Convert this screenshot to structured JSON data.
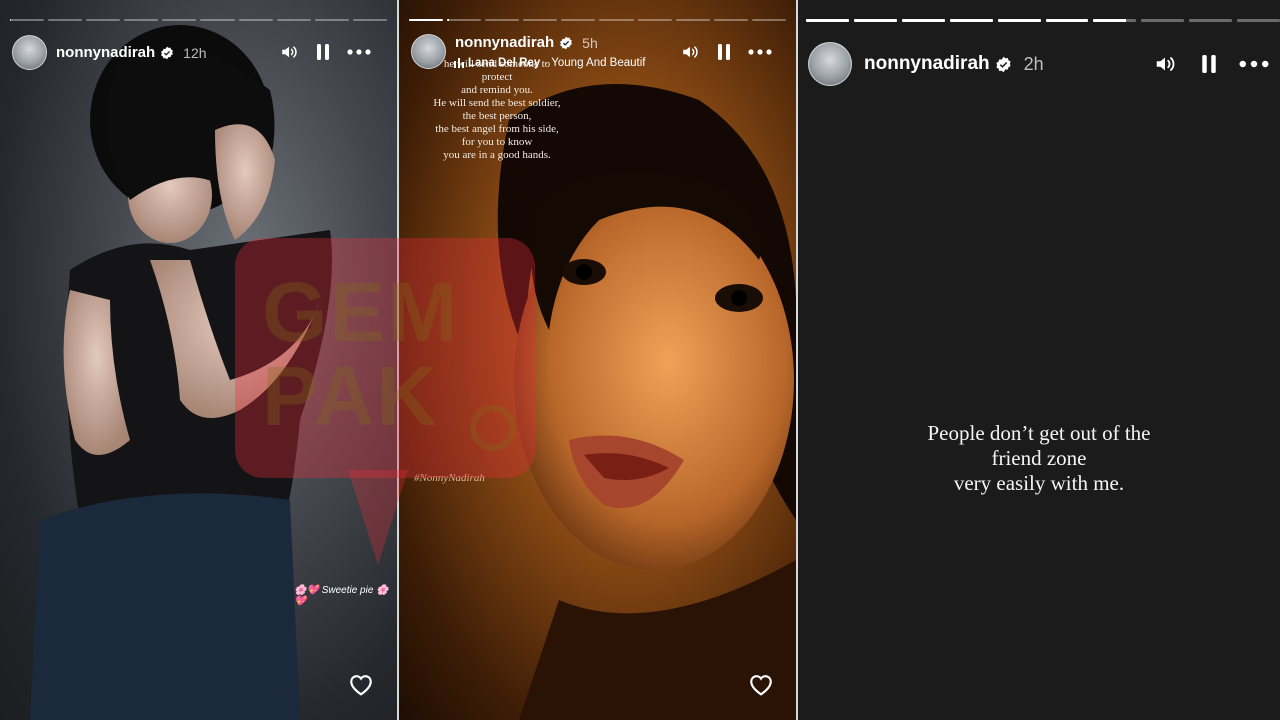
{
  "stories": [
    {
      "username": "nonnynadirah",
      "time": "12h",
      "progress_bars": [
        0.02,
        0,
        0,
        0,
        0,
        0,
        0,
        0,
        0,
        0
      ],
      "sticker_text": "Sweetie pie",
      "sticker_emojis": "🌸💖"
    },
    {
      "username": "nonnynadirah",
      "time": "5h",
      "progress_bars": [
        1,
        0.05,
        0,
        0,
        0,
        0,
        0,
        0,
        0,
        0
      ],
      "music_artist": "Lana Del Rey",
      "music_song": "Young And Beautif",
      "poem_lines": [
        "he will send someone to",
        "protect",
        "and remind you.",
        "He will send the best soldier,",
        "the best person,",
        "the best angel from his side,",
        "for you to know",
        "you are in a good hands."
      ],
      "hashtag": "#NonnyNadirah"
    },
    {
      "username": "nonnynadirah",
      "time": "2h",
      "progress_bars": [
        1,
        1,
        1,
        1,
        1,
        1,
        0.75,
        0,
        0,
        0
      ],
      "quote_lines": [
        "People don’t get out of the",
        "friend zone",
        "very easily with me."
      ]
    }
  ],
  "watermark": {
    "line1": "GEM",
    "line2": "PAK"
  },
  "colors": {
    "progress_active": "#ffffff",
    "progress_inactive": "rgba(255,255,255,0.35)",
    "watermark_pink": "#eb2d3c",
    "verified_blue": "#ffffff"
  },
  "icons": {
    "volume": "volume-icon",
    "pause": "pause-icon",
    "more": "more-icon",
    "heart": "heart-icon",
    "verified": "verified-badge-icon",
    "music": "music-bars-icon"
  }
}
